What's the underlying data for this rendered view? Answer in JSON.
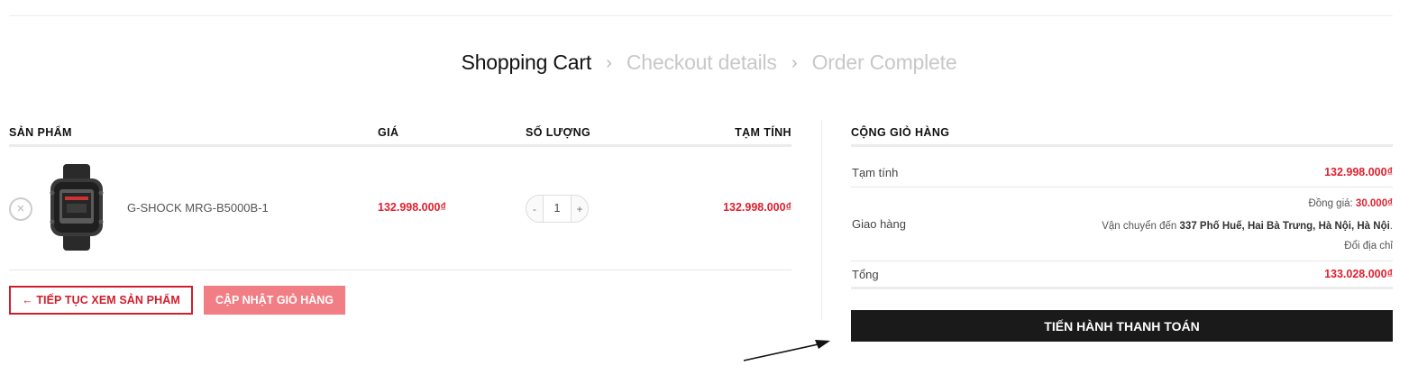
{
  "breadcrumb": {
    "step1": "Shopping Cart",
    "step2": "Checkout details",
    "step3": "Order Complete",
    "separator": "›"
  },
  "table": {
    "col_product": "SẢN PHẨM",
    "col_price": "GIÁ",
    "col_qty": "SỐ LƯỢNG",
    "col_subtotal": "TẠM TÍNH"
  },
  "item": {
    "remove": "×",
    "name": "G-SHOCK MRG-B5000B-1",
    "price": "132.998.000₫",
    "qty_minus": "-",
    "qty": "1",
    "qty_plus": "+",
    "subtotal": "132.998.000₫"
  },
  "actions": {
    "continue": "← TIẾP TỤC XEM SẢN PHẨM",
    "update": "CẬP NHẬT GIỎ HÀNG"
  },
  "totals": {
    "title": "CỘNG GIỎ HÀNG",
    "subtotal_label": "Tạm tính",
    "subtotal_value": "132.998.000₫",
    "shipping_label": "Giao hàng",
    "flat_rate_label": "Đồng giá:",
    "flat_rate_value": "30.000₫",
    "ship_to_prefix": "Vận chuyển đến",
    "ship_to_address": "337 Phố Huế, Hai Bà Trưng, Hà Nội, Hà Nội",
    "ship_to_suffix": ".",
    "change_address": "Đổi địa chỉ",
    "total_label": "Tổng",
    "total_value": "133.028.000₫",
    "checkout": "TIẾN HÀNH THANH TOÁN"
  },
  "colors": {
    "accent": "#e0202f",
    "update_button": "#f17e84",
    "checkout_button": "#1a1a1a"
  }
}
